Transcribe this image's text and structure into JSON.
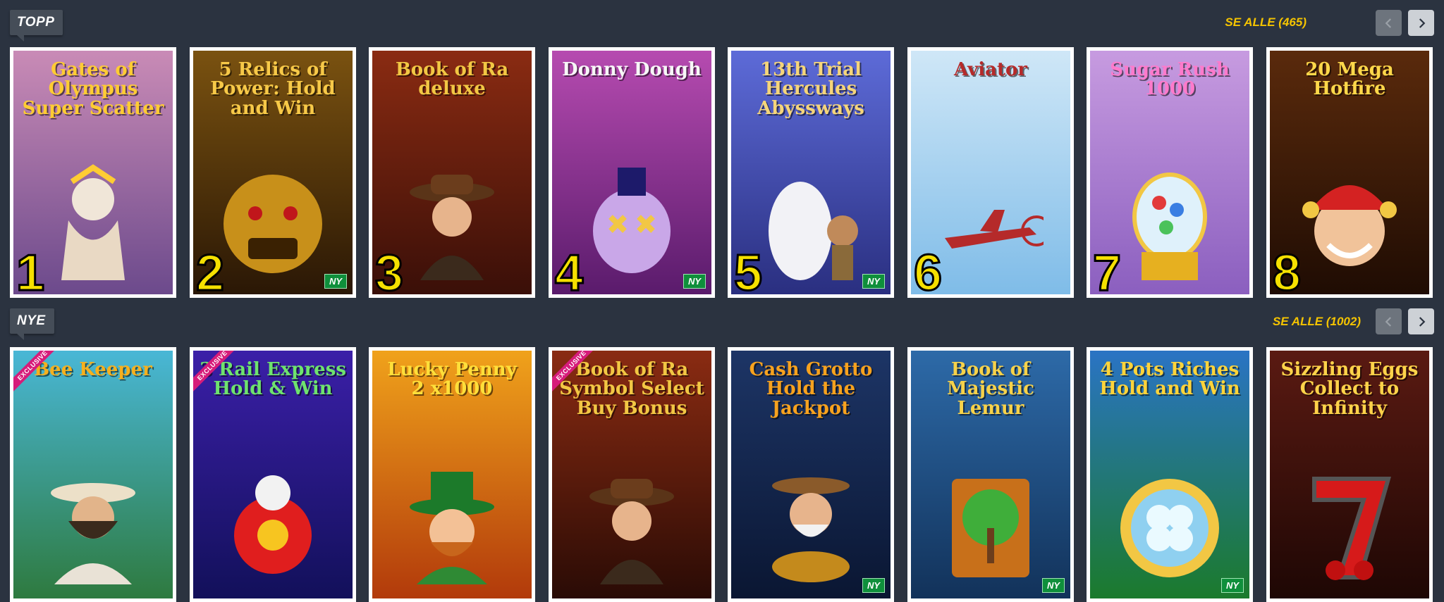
{
  "sections": {
    "top": {
      "label": "TOPP",
      "see_all": "SE ALLE (465)",
      "games": [
        {
          "title": "Gates of Olympus Super Scatter",
          "rank": "1",
          "new": "",
          "bg": "#c98bb6",
          "bg2": "#6c4a8c",
          "title_color": "#ffcc33",
          "figure": "zeus"
        },
        {
          "title": "5 Relics of Power: Hold and Win",
          "rank": "2",
          "new": "NY",
          "bg": "#7a5210",
          "bg2": "#2a1705",
          "title_color": "#f7c948",
          "figure": "golden-mask"
        },
        {
          "title": "Book of Ra deluxe",
          "rank": "3",
          "new": "",
          "bg": "#8a2b12",
          "bg2": "#3a0f08",
          "title_color": "#f2c744",
          "figure": "explorer"
        },
        {
          "title": "Donny Dough",
          "rank": "4",
          "new": "NY",
          "bg": "#b64bb0",
          "bg2": "#5a1b6c",
          "title_color": "#f7f7f7",
          "figure": "clown"
        },
        {
          "title": "13th Trial Hercules Abyssways",
          "rank": "5",
          "new": "NY",
          "bg": "#5d6bd8",
          "bg2": "#2a2f80",
          "title_color": "#f5d57a",
          "figure": "pegasus"
        },
        {
          "title": "Aviator",
          "rank": "6",
          "new": "",
          "bg": "#cfe7f7",
          "bg2": "#7fbce8",
          "title_color": "#b52a2a",
          "figure": "airplane"
        },
        {
          "title": "Sugar Rush 1000",
          "rank": "7",
          "new": "",
          "bg": "#c79be0",
          "bg2": "#8b5fbf",
          "title_color": "#ff7acb",
          "figure": "gumball"
        },
        {
          "title": "20 Mega Hotfire",
          "rank": "8",
          "new": "",
          "bg": "#5a2a0c",
          "bg2": "#1f0c03",
          "title_color": "#ffd84a",
          "figure": "jester"
        }
      ]
    },
    "new": {
      "label": "NYE",
      "see_all": "SE ALLE (1002)",
      "games": [
        {
          "title": "Bee Keeper",
          "exclusive": "EXCLUSIVE",
          "new": "",
          "bg": "#49b7d6",
          "bg2": "#2e7a3f",
          "title_color": "#f6b01e",
          "figure": "beekeeper"
        },
        {
          "title": "3 Rail Express Hold & Win",
          "exclusive": "EXCLUSIVE",
          "new": "",
          "bg": "#3b1fa8",
          "bg2": "#12105a",
          "title_color": "#6ee36e",
          "figure": "train"
        },
        {
          "title": "Lucky Penny 2 x1000",
          "exclusive": "",
          "new": "",
          "bg": "#f0a21b",
          "bg2": "#b23a0b",
          "title_color": "#ffdf3a",
          "figure": "leprechaun"
        },
        {
          "title": "Book of Ra Symbol Select Buy Bonus",
          "exclusive": "EXCLUSIVE",
          "new": "",
          "bg": "#8a2b12",
          "bg2": "#2a0b05",
          "title_color": "#f2c744",
          "figure": "explorer"
        },
        {
          "title": "Cash Grotto Hold the Jackpot",
          "exclusive": "",
          "new": "NY",
          "bg": "#1d3566",
          "bg2": "#0a1632",
          "title_color": "#f7a21e",
          "figure": "miner"
        },
        {
          "title": "Book of Majestic Lemur",
          "exclusive": "",
          "new": "NY",
          "bg": "#2d6aa8",
          "bg2": "#12325a",
          "title_color": "#f7d24a",
          "figure": "tree-book"
        },
        {
          "title": "4 Pots Riches Hold and Win",
          "exclusive": "",
          "new": "NY",
          "bg": "#2a74c4",
          "bg2": "#1b7a2c",
          "title_color": "#ffd43a",
          "figure": "clover-coin"
        },
        {
          "title": "Sizzling Eggs Collect to Infinity",
          "exclusive": "",
          "new": "",
          "bg": "#5a1a12",
          "bg2": "#1e0704",
          "title_color": "#ffd34a",
          "figure": "seven"
        }
      ]
    }
  },
  "colors": {
    "background": "#2b3340",
    "accent": "#f5c400",
    "badge_new": "#0f8f3b",
    "rank": "#f5e000"
  },
  "icons": {
    "prev": "chevron-left-icon",
    "next": "chevron-right-icon"
  }
}
